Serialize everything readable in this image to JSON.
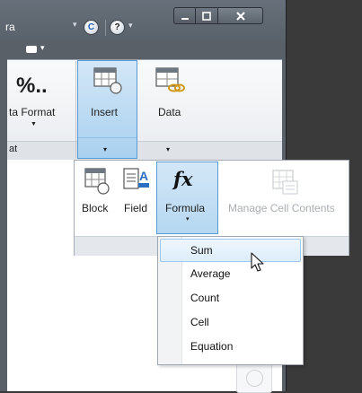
{
  "window": {
    "title_fragment": "ra",
    "title_dropdown_glyph": "▾",
    "help_label": "?",
    "restore_label": "C"
  },
  "quick_access": {
    "dropdown_glyph": "▾"
  },
  "ribbon": {
    "format_group": {
      "percent_label": "%..",
      "format_label": "ta Format",
      "group_label": "at"
    },
    "insert_button": {
      "label": "Insert",
      "caret": "▾"
    },
    "data_button": {
      "label": "Data",
      "caret": "▾"
    }
  },
  "insert_panel": {
    "block_label": "Block",
    "field_label": "Field",
    "formula_label": "Formula",
    "formula_glyph": "fx",
    "formula_caret": "▾",
    "manage_label": "Manage Cell Contents"
  },
  "formula_menu": {
    "items": [
      {
        "label": "Sum"
      },
      {
        "label": "Average"
      },
      {
        "label": "Count"
      },
      {
        "label": "Cell"
      },
      {
        "label": "Equation"
      }
    ],
    "hovered_item": "Sum"
  },
  "colors": {
    "chrome": "#5a6068",
    "selected_fill": "#b5d7f1",
    "selected_border": "#5b9bd5",
    "disabled_text": "#a9aeb4"
  }
}
